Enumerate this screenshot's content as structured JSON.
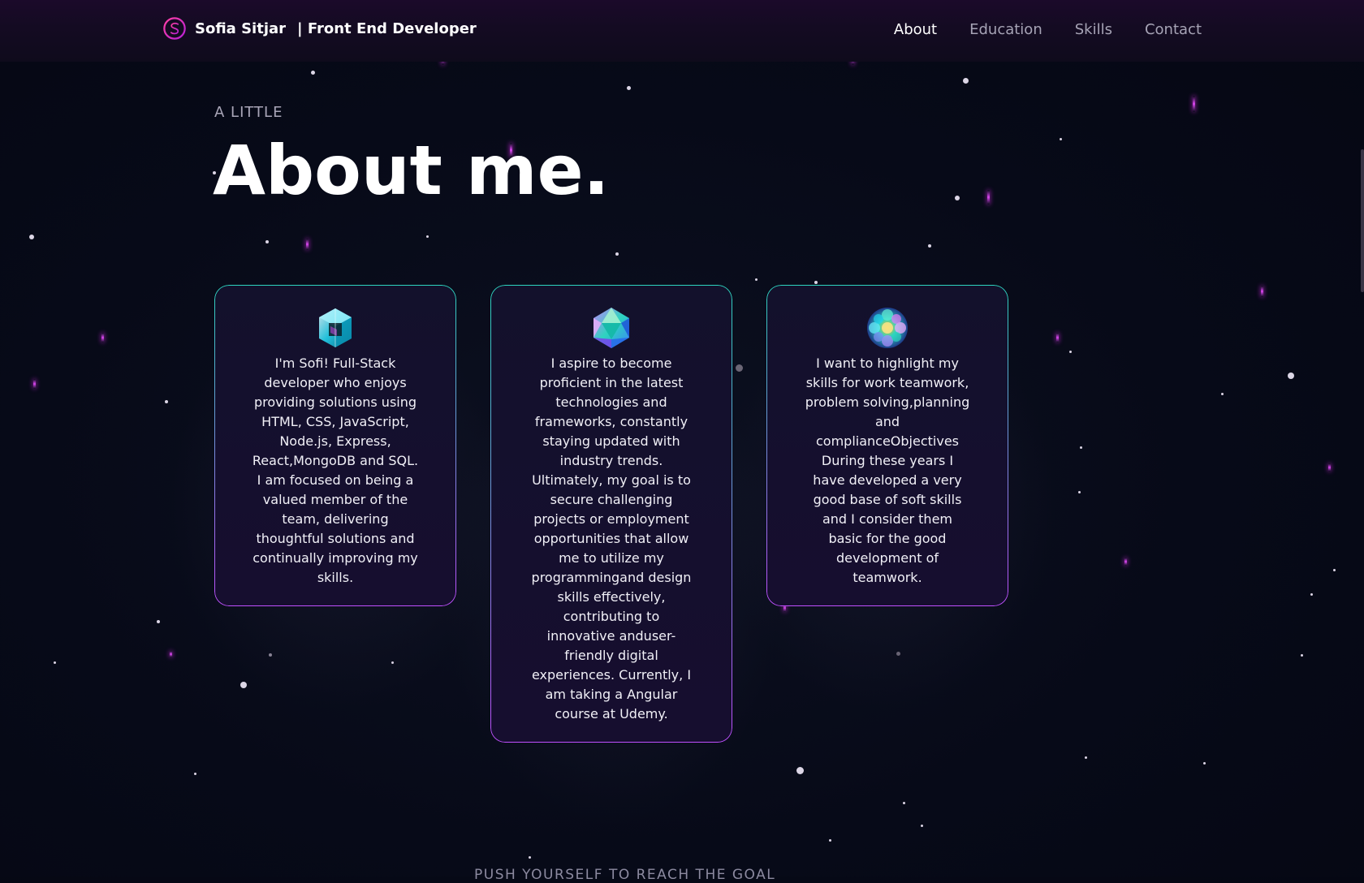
{
  "header": {
    "brand_name": "Sofia Sitjar",
    "brand_role": "| Front End Developer",
    "nav": [
      {
        "label": "About",
        "active": true
      },
      {
        "label": "Education",
        "active": false
      },
      {
        "label": "Skills",
        "active": false
      },
      {
        "label": "Contact",
        "active": false
      }
    ]
  },
  "hero": {
    "subtitle": "A LITTLE",
    "title": "About me."
  },
  "cards": [
    {
      "icon": "teal-cube-icon",
      "text": "I'm Sofi! Full-Stack developer who enjoys providing solutions using HTML, CSS, JavaScript, Node.js, Express, React,MongoDB and SQL. I am focused on being a valued member of the team, delivering thoughtful solutions and continually improving my skills."
    },
    {
      "icon": "crystal-gem-icon",
      "text": "I aspire to become proficient in the latest technologies and frameworks, constantly staying updated with industry trends. Ultimately, my goal is to secure challenging projects or employment opportunities that allow me to utilize my programmingand design skills effectively, contributing to innovative anduser-friendly digital experiences. Currently, I am taking a Angular course at Udemy."
    },
    {
      "icon": "flower-sphere-icon",
      "text": "I want to highlight my skills for work teamwork, problem solving,planning and complianceObjectives During these years I have developed a very good base of soft skills and I consider them basic for the good development of teamwork."
    }
  ],
  "footer_teaser": "PUSH YOURSELF TO REACH THE GOAL",
  "colors": {
    "accent_pink": "#e13fb0",
    "card_border_top": "#2dd4bf",
    "card_border_bottom": "#c04fff",
    "background": "#070a18"
  }
}
